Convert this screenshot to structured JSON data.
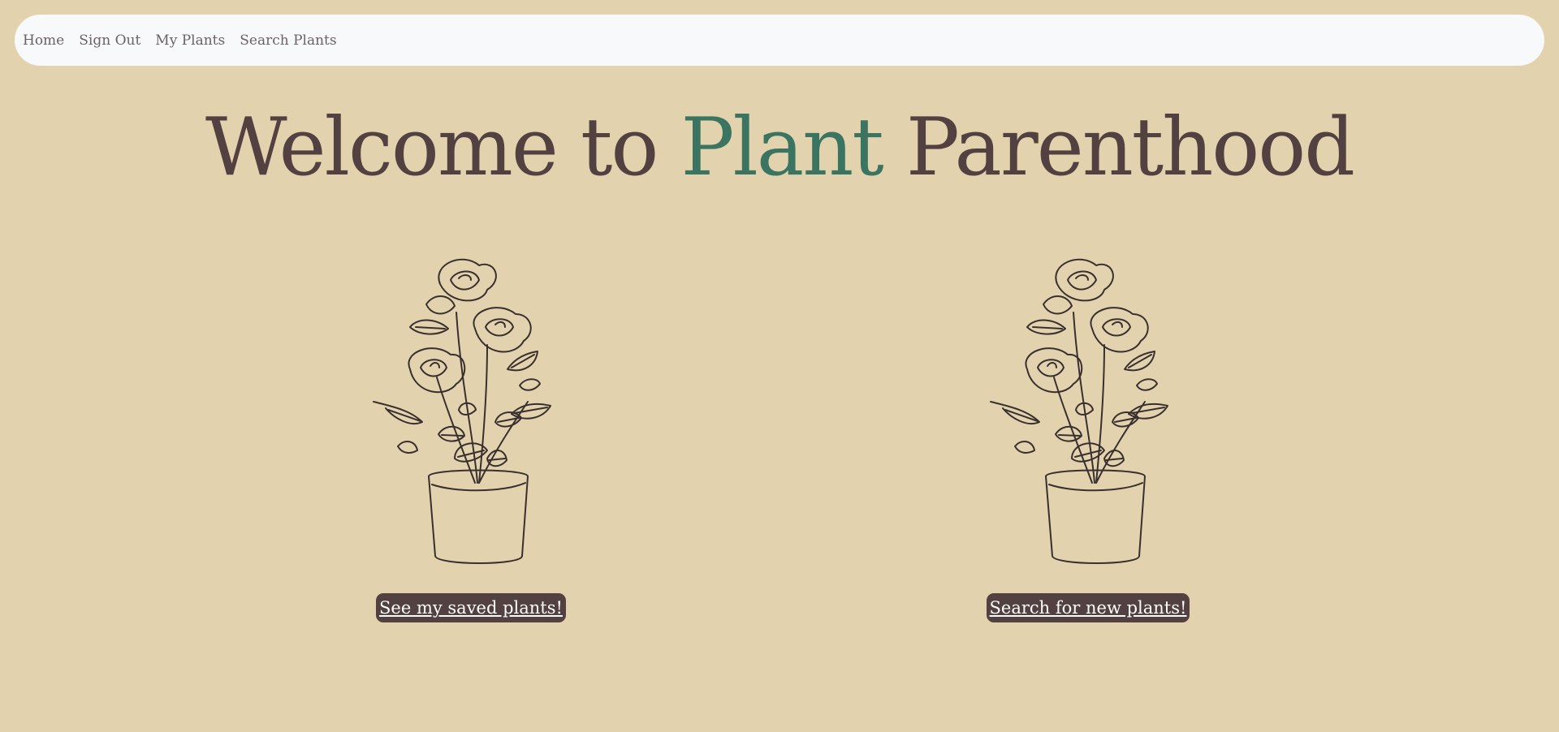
{
  "nav": {
    "items": [
      {
        "label": "Home"
      },
      {
        "label": "Sign Out"
      },
      {
        "label": "My Plants"
      },
      {
        "label": "Search Plants"
      }
    ]
  },
  "hero": {
    "title_before": "Welcome to ",
    "title_accent": "Plant",
    "title_after": " Parenthood"
  },
  "cards": [
    {
      "image": "potted-rose-plant-illustration",
      "button_label": "See my saved plants!"
    },
    {
      "image": "potted-rose-plant-illustration",
      "button_label": "Search for new plants!"
    }
  ],
  "colors": {
    "background": "#e2d3ae",
    "navbar": "#f7f9fb",
    "title": "#534041",
    "accent": "#3b7561",
    "button": "#534041",
    "button_text": "#ffffff"
  }
}
